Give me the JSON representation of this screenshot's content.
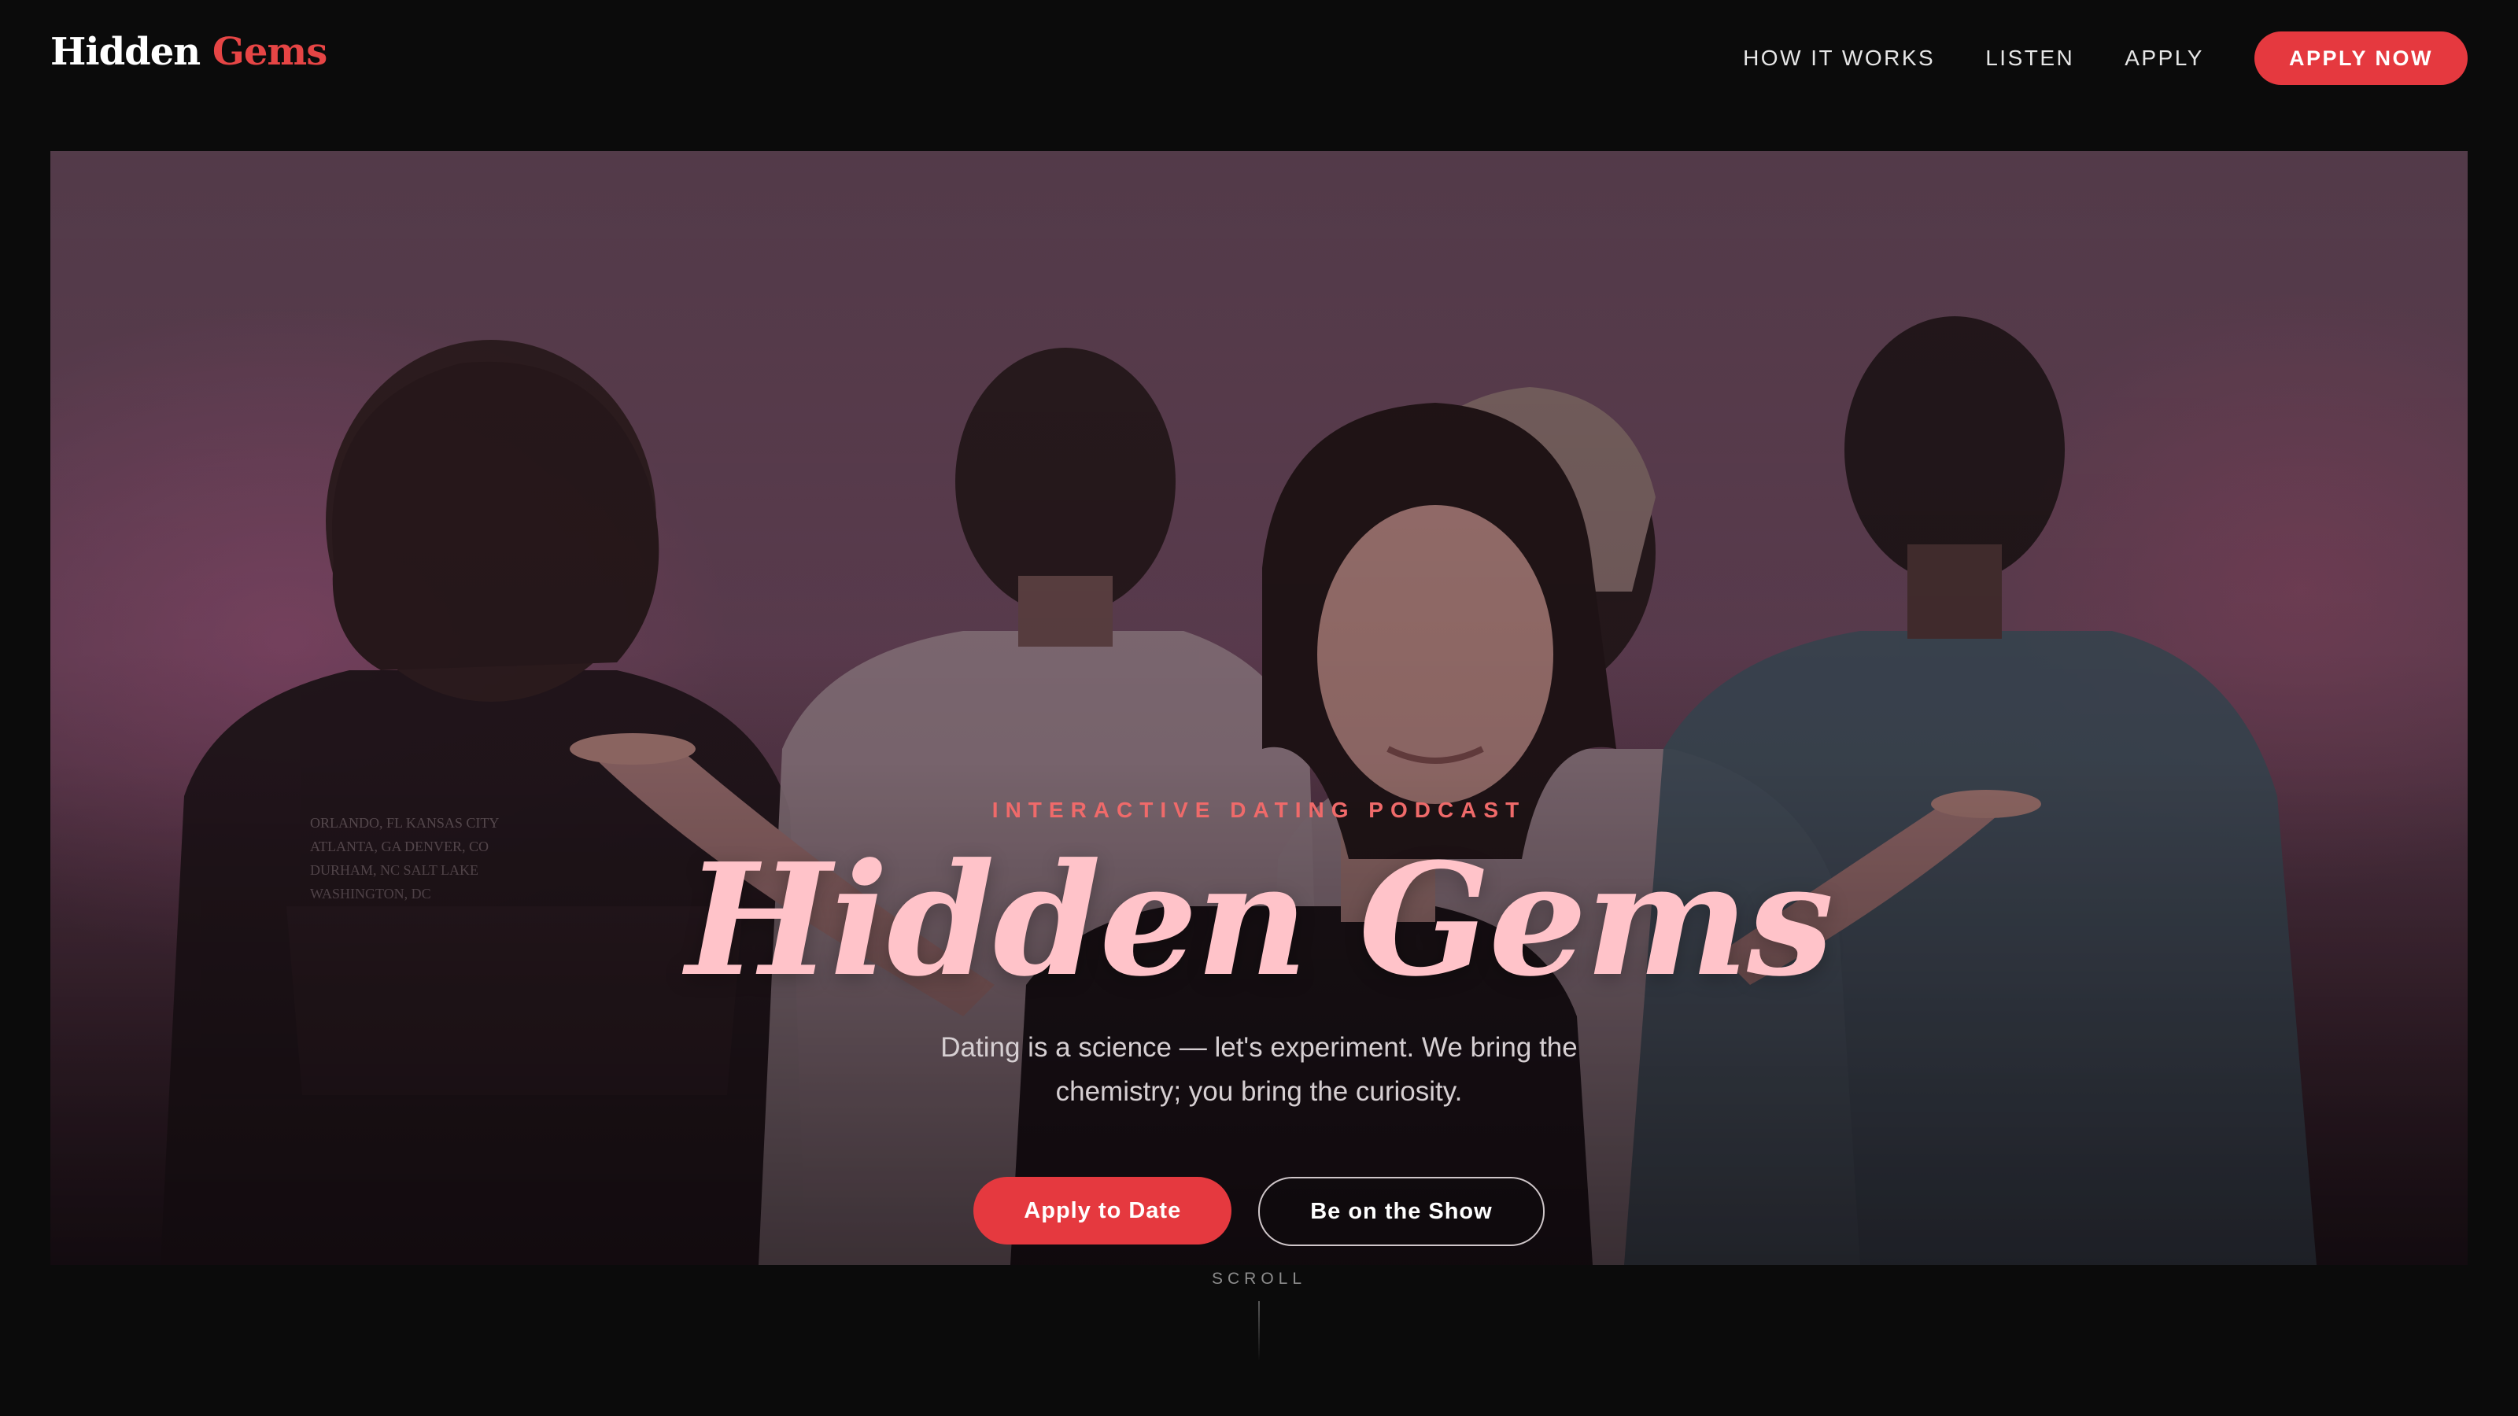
{
  "brand": {
    "logo_main": "Hidden",
    "logo_accent": "Gems",
    "accent_color": "#e5393f"
  },
  "nav": {
    "links": [
      "HOW IT WORKS",
      "LISTEN",
      "APPLY"
    ],
    "cta_label": "APPLY NOW"
  },
  "hero": {
    "eyebrow": "INTERACTIVE DATING PODCAST",
    "title": "Hidden Gems",
    "tagline_line1": "Dating is a science — let's experiment. We bring the",
    "tagline_line2": "chemistry; you bring the curiosity.",
    "primary_button": "Apply to Date",
    "secondary_button": "Be on the Show",
    "image_description_icon": "hero-photo"
  },
  "scroll": {
    "label": "SCROLL"
  }
}
